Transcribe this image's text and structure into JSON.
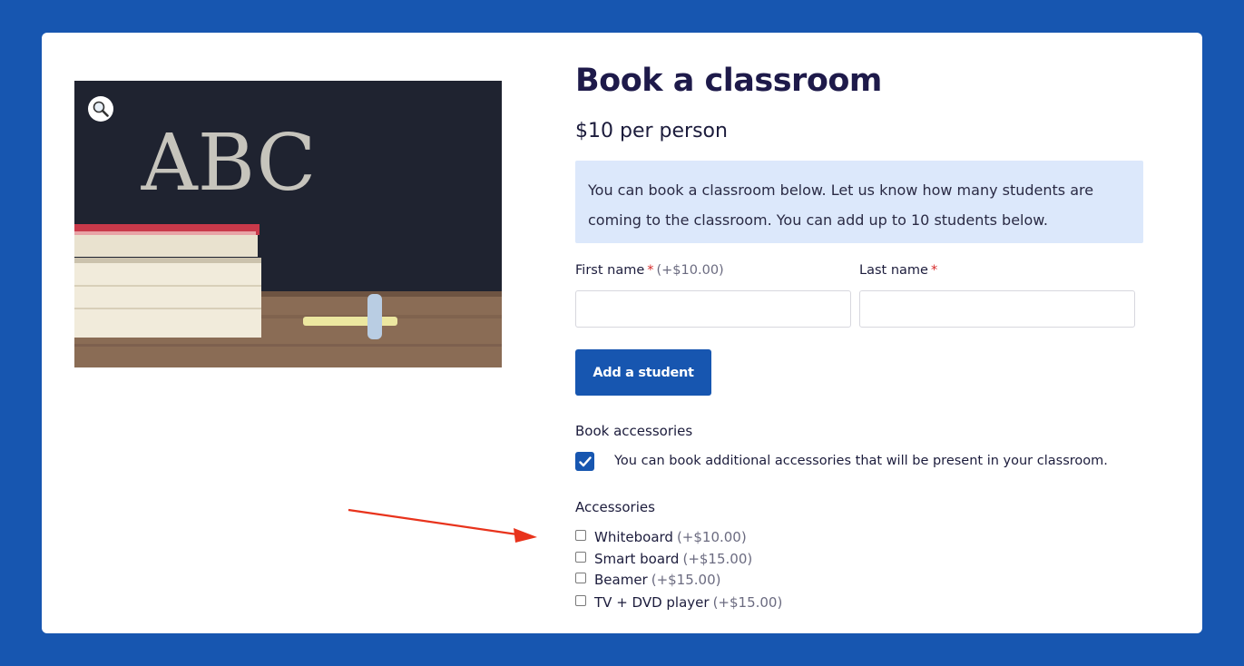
{
  "product": {
    "title": "Book a classroom",
    "price": "$10 per person",
    "image_icon": "zoom-icon",
    "chalkboard_text": "ABC"
  },
  "notice": {
    "text": "You can book a classroom below. Let us know how many students are coming to the classroom. You can add up to 10 students below."
  },
  "form": {
    "first_name_label": "First name",
    "first_name_required": "*",
    "first_name_price": "(+$10.00)",
    "first_name_value": "",
    "last_name_label": "Last name",
    "last_name_required": "*",
    "last_name_value": "",
    "add_student_label": "Add a student"
  },
  "book_accessories": {
    "label": "Book accessories",
    "checked": true,
    "checkbox_label": "You can book additional accessories that will be present in your classroom."
  },
  "accessories": {
    "label": "Accessories",
    "options": [
      {
        "name": "Whiteboard",
        "price": "(+$10.00)",
        "checked": false
      },
      {
        "name": "Smart board",
        "price": "(+$15.00)",
        "checked": false
      },
      {
        "name": "Beamer",
        "price": "(+$15.00)",
        "checked": false
      },
      {
        "name": "TV + DVD player",
        "price": "(+$15.00)",
        "checked": false
      }
    ]
  },
  "colors": {
    "background": "#1756b0",
    "accent": "#1756b0",
    "notice_bg": "#dce8fb",
    "required": "#d62828",
    "annotation_arrow": "#e8331c"
  }
}
